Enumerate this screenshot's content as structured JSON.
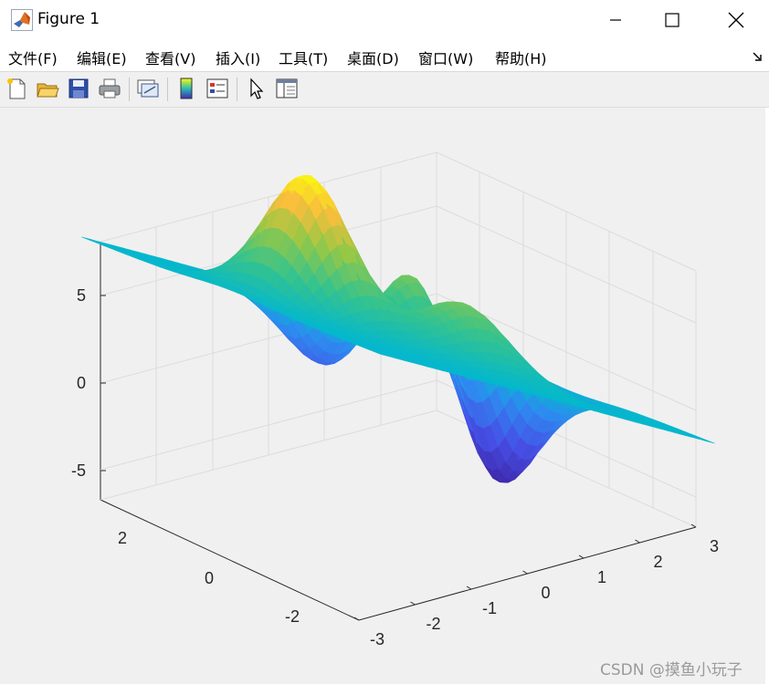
{
  "window": {
    "title": "Figure 1",
    "icon": "matlab-logo-icon",
    "controls": [
      "minimize-icon",
      "maximize-icon",
      "close-icon"
    ]
  },
  "menu": {
    "items": [
      {
        "label": "文件(F)"
      },
      {
        "label": "编辑(E)"
      },
      {
        "label": "查看(V)"
      },
      {
        "label": "插入(I)"
      },
      {
        "label": "工具(T)"
      },
      {
        "label": "桌面(D)"
      },
      {
        "label": "窗口(W)"
      },
      {
        "label": "帮助(H)"
      }
    ],
    "dock_icon": "dock-arrow-icon"
  },
  "toolbar": {
    "icons": [
      "new-figure-icon",
      "open-file-icon",
      "save-icon",
      "print-icon",
      "link-plot-icon",
      "insert-colorbar-icon",
      "insert-legend-icon",
      "edit-plot-icon",
      "property-inspector-icon"
    ]
  },
  "chart_data": {
    "type": "surface",
    "function": "peaks",
    "x": [
      -3,
      3
    ],
    "y": [
      -3,
      3
    ],
    "zlim": [
      -6.55,
      8.1
    ],
    "xticks": [
      "-3",
      "-2",
      "-1",
      "0",
      "1",
      "2",
      "3"
    ],
    "yticks": [
      "-2",
      "0",
      "2"
    ],
    "zticks": [
      "-5",
      "0",
      "5"
    ],
    "z_peak_max": 8.1,
    "z_peak_min": -6.55,
    "contour_levels_step": 0.8,
    "colormap": "parula",
    "view": "3d-default",
    "grid": true,
    "colors": {
      "low": "#3e2ab5",
      "mid_low": "#2d8cf0",
      "zero": "#05b8cc",
      "mid_high": "#62c864",
      "high": "#f9fb0e"
    }
  },
  "footer": {
    "watermark": "CSDN @摸鱼小玩子"
  }
}
